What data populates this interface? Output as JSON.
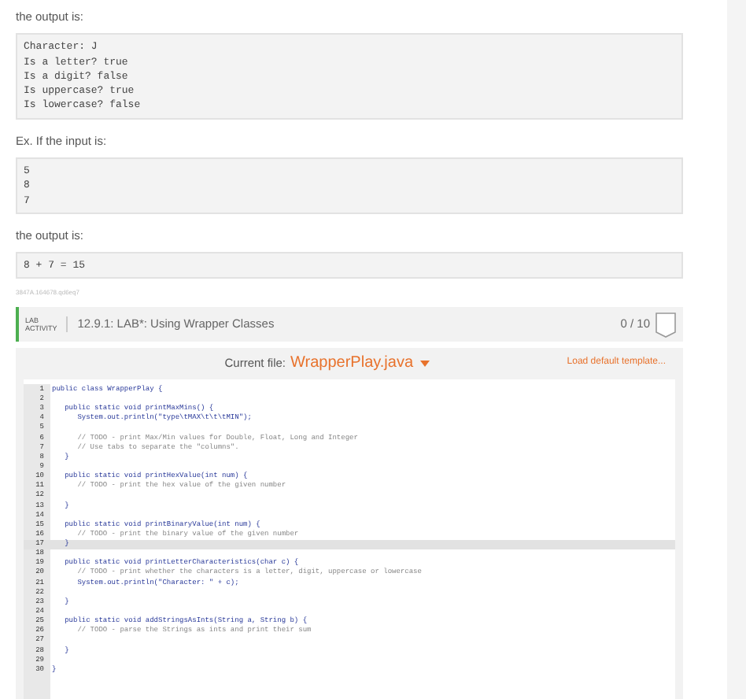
{
  "blocks": [
    {
      "kind": "text",
      "text": "the output is:"
    },
    {
      "kind": "pre",
      "lines": [
        "Character: J",
        "Is a letter? true",
        "Is a digit? false",
        "Is uppercase? true",
        "Is lowercase? false"
      ]
    },
    {
      "kind": "text",
      "text": "Ex. If the input is:"
    },
    {
      "kind": "pre",
      "lines": [
        "5",
        "8",
        "7"
      ]
    },
    {
      "kind": "text",
      "text": "the output is:"
    },
    {
      "kind": "pre",
      "lines": [
        "8 + 7 = 15"
      ]
    },
    {
      "kind": "id",
      "text": "3847A.164678.qd6eq7"
    }
  ],
  "lab": {
    "badge_top": "LAB",
    "badge_bottom": "ACTIVITY",
    "title": "12.9.1: LAB*: Using Wrapper Classes",
    "score": "0 / 10"
  },
  "editor": {
    "file_label": "Current file:",
    "file_name": "WrapperPlay.java",
    "load_link": "Load default template...",
    "lines": [
      {
        "n": "1",
        "text": "public class WrapperPlay {",
        "kind": "code",
        "selected": false
      },
      {
        "n": "2",
        "selected": false
      },
      {
        "n": "3",
        "text": "   public static void printMaxMins() {",
        "kind": "code",
        "selected": false
      },
      {
        "n": "4",
        "text": "      System.out.println(\"type\\tMAX\\t\\t\\tMIN\");",
        "kind": "code",
        "selected": false
      },
      {
        "n": "5",
        "selected": false
      },
      {
        "n": "6",
        "text": "      // TODO - print Max/Min values for Double, Float, Long and Integer",
        "kind": "comment",
        "selected": false
      },
      {
        "n": "7",
        "text": "      // Use tabs to separate the \"columns\".",
        "kind": "comment",
        "selected": false
      },
      {
        "n": "8",
        "text": "   }",
        "kind": "code",
        "selected": false
      },
      {
        "n": "9",
        "selected": false
      },
      {
        "n": "10",
        "text": "   public static void printHexValue(int num) {",
        "kind": "code",
        "selected": false
      },
      {
        "n": "11",
        "text": "      // TODO - print the hex value of the given number",
        "kind": "comment",
        "selected": false
      },
      {
        "n": "12",
        "selected": false
      },
      {
        "n": "13",
        "text": "   }",
        "kind": "code",
        "selected": false
      },
      {
        "n": "14",
        "selected": false
      },
      {
        "n": "15",
        "text": "   public static void printBinaryValue(int num) {",
        "kind": "code",
        "selected": false
      },
      {
        "n": "16",
        "text": "      // TODO - print the binary value of the given number",
        "kind": "comment",
        "selected": false
      },
      {
        "n": "17",
        "text": "   }",
        "kind": "code",
        "selected": true
      },
      {
        "n": "18",
        "selected": false
      },
      {
        "n": "19",
        "text": "   public static void printLetterCharacteristics(char c) {",
        "kind": "code",
        "selected": false
      },
      {
        "n": "20",
        "text": "      // TODO - print whether the characters is a letter, digit, uppercase or lowercase",
        "kind": "comment",
        "selected": false
      },
      {
        "n": "21",
        "text": "      System.out.println(\"Character: \" + c);",
        "kind": "code",
        "selected": false
      },
      {
        "n": "22",
        "selected": false
      },
      {
        "n": "23",
        "text": "   }",
        "kind": "code",
        "selected": false
      },
      {
        "n": "24",
        "selected": false
      },
      {
        "n": "25",
        "text": "   public static void addStringsAsInts(String a, String b) {",
        "kind": "code",
        "selected": false
      },
      {
        "n": "26",
        "text": "      // TODO - parse the Strings as ints and print their sum",
        "kind": "comment",
        "selected": false
      },
      {
        "n": "27",
        "selected": false
      },
      {
        "n": "28",
        "text": "   }",
        "kind": "code",
        "selected": false
      },
      {
        "n": "29",
        "selected": false
      },
      {
        "n": "30",
        "text": "}",
        "kind": "code",
        "selected": false
      }
    ]
  }
}
